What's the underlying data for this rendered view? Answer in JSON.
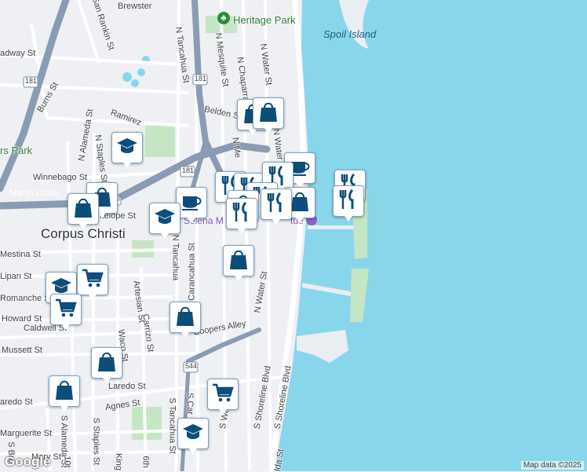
{
  "map": {
    "city_label": "Corpus Christi",
    "water_labels": [
      "Spoil Island"
    ],
    "park_labels": [
      "Heritage Park",
      "rs Park"
    ],
    "poi_labels": [
      "Selena M",
      "tue"
    ],
    "street_labels": [
      "Brewster",
      "adway St",
      "San Rankin St",
      "Burns St",
      "N Tancahua St",
      "N Mesquite St",
      "N Chaparral",
      "N Water St",
      "Ramirez",
      "Belden St",
      "N Staples St",
      "N Alameda St",
      "Winnebago St",
      "N Me",
      "N Water",
      "Martin Luther",
      "Antelope St",
      "Mestina St",
      "Lipan St",
      "Romanche St",
      "Howard St",
      "Caldwell St",
      "Mussett St",
      "Laredo St",
      "Agnes St",
      "Marguerite St",
      "aredo St",
      "N Tancahua",
      "Carancahua St",
      "Artesian St",
      "Carrizo St",
      "Waco St",
      "Coopers Alley",
      "N Water St",
      "S Shoreline Blvd",
      "S Shoreline Blvd",
      "S Water St",
      "S Tancahua St",
      "S Car",
      "S Staples St",
      "S Alameda St",
      "10t",
      "King",
      "6th",
      "S Bro",
      "Mary St",
      "lda St"
    ],
    "highway_shields": [
      "181",
      "181",
      "181",
      "544",
      "37"
    ],
    "attribution": "Map data ©2025",
    "logo": "Google"
  },
  "colors": {
    "water": "#88d6ec",
    "land": "#eef0f3",
    "road": "#ffffff",
    "highway": "#8a9cb3",
    "park": "#c4e6c4",
    "pin_icon": "#0d4d7a"
  },
  "markers": [
    {
      "icon": "shopping-bag",
      "label": ""
    },
    {
      "icon": "shopping-bag",
      "label": ""
    },
    {
      "icon": "graduation-cap",
      "label": ""
    },
    {
      "icon": "coffee-cup",
      "label": ""
    },
    {
      "icon": "restaurant",
      "label": ""
    },
    {
      "icon": "restaurant",
      "label": ""
    },
    {
      "icon": "shopping-bag",
      "label": ""
    },
    {
      "icon": "shopping-bag",
      "label": ""
    },
    {
      "icon": "coffee-cup",
      "label": ""
    },
    {
      "icon": "graduation-cap",
      "label": ""
    },
    {
      "icon": "restaurant",
      "label": ""
    },
    {
      "icon": "restaurant",
      "label": ""
    },
    {
      "icon": "restaurant",
      "label": ""
    },
    {
      "icon": "restaurant",
      "label": ""
    },
    {
      "icon": "shopping-bag",
      "label": ""
    },
    {
      "icon": "shopping-bag",
      "label": ""
    },
    {
      "icon": "restaurant",
      "label": ""
    },
    {
      "icon": "restaurant",
      "label": ""
    },
    {
      "icon": "shopping-bag",
      "label": ""
    },
    {
      "icon": "graduation-cap",
      "label": ""
    },
    {
      "icon": "shopping-cart",
      "label": ""
    },
    {
      "icon": "shopping-cart",
      "label": ""
    },
    {
      "icon": "shopping-bag",
      "label": ""
    },
    {
      "icon": "shopping-bag",
      "label": ""
    },
    {
      "icon": "shopping-bag",
      "label": ""
    },
    {
      "icon": "shopping-cart",
      "label": ""
    },
    {
      "icon": "graduation-cap",
      "label": ""
    }
  ]
}
